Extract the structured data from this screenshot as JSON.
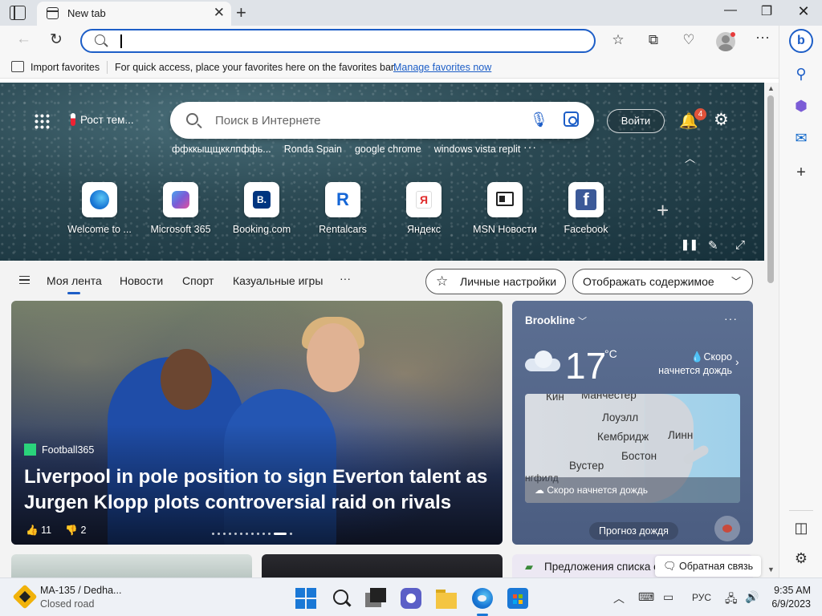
{
  "browser": {
    "tab_title": "New tab",
    "address_value": "",
    "favorites_bar": {
      "import_label": "Import favorites",
      "message": "For quick access, place your favorites here on the favorites bar.",
      "manage_link": "Manage favorites now"
    }
  },
  "newtab": {
    "weather_chip": "Рост тем...",
    "search_placeholder": "Поиск в Интернете",
    "signin_label": "Войти",
    "notification_count": "4",
    "trending": [
      "ффккыщщкклпффь...",
      "Ronda Spain",
      "google chrome",
      "windows vista replit"
    ],
    "quick_links": [
      {
        "label": "Welcome to ...",
        "icon": "edge-icon"
      },
      {
        "label": "Microsoft 365",
        "icon": "m365-icon"
      },
      {
        "label": "Booking.com",
        "icon": "booking-icon",
        "glyph": "B."
      },
      {
        "label": "Rentalcars",
        "icon": "rentalcars-icon",
        "glyph": "R"
      },
      {
        "label": "Яндекс",
        "icon": "yandex-icon",
        "glyph": "Я"
      },
      {
        "label": "MSN Новости",
        "icon": "msn-news-icon"
      },
      {
        "label": "Facebook",
        "icon": "facebook-icon",
        "glyph": "f"
      }
    ],
    "nav_tabs": [
      "Моя лента",
      "Новости",
      "Спорт",
      "Казуальные игры"
    ],
    "personalize_label": "Личные настройки",
    "content_display_label": "Отображать содержимое",
    "hero_story": {
      "source": "Football365",
      "headline": "Liverpool in pole position to sign Everton talent as Jurgen Klopp plots controversial raid on rivals",
      "likes": "11",
      "dislikes": "2",
      "slide_count": 13,
      "active_slide": 12
    },
    "weather_card": {
      "location": "Brookline",
      "temperature": "17",
      "unit": "°C",
      "rain_note": "Скоро начнется дождь",
      "map_cities": [
        "Кин",
        "Манчестер",
        "Лоуэлл",
        "Кембридж",
        "Линн",
        "Вустер",
        "Бостон",
        "нгфилд"
      ],
      "map_banner": "Скоро начнется дождь",
      "forecast_button": "Прогноз дождя"
    },
    "bottom_card_text": "Предложения списка отелей",
    "feedback_label": "Обратная связь"
  },
  "taskbar": {
    "traffic_title": "MA-135 / Dedha...",
    "traffic_status": "Closed road",
    "language": "РУС",
    "time": "9:35 AM",
    "date": "6/9/2023"
  },
  "colors": {
    "accent": "#1d5ec7",
    "weather_card": "#52658a",
    "hero_story_source": "#2ad47b"
  }
}
